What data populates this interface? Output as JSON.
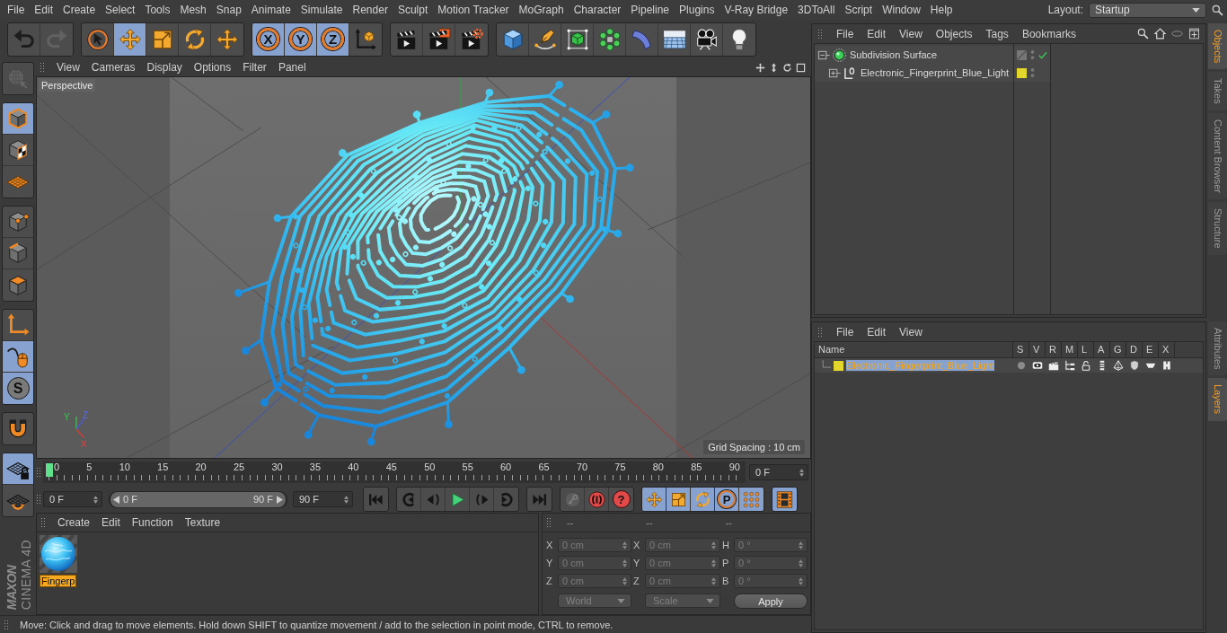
{
  "menu_bar": {
    "items": [
      "File",
      "Edit",
      "Create",
      "Select",
      "Tools",
      "Mesh",
      "Snap",
      "Animate",
      "Simulate",
      "Render",
      "Sculpt",
      "Motion Tracker",
      "MoGraph",
      "Character",
      "Pipeline",
      "Plugins",
      "V-Ray Bridge",
      "3DToAll",
      "Script",
      "Window",
      "Help"
    ],
    "layout_label": "Layout:",
    "layout_value": "Startup"
  },
  "toolbar": [
    [
      {
        "kind": "undo",
        "selected": false,
        "disabled": false
      },
      {
        "kind": "redo",
        "selected": false,
        "disabled": true
      }
    ],
    [
      {
        "kind": "select",
        "selected": false,
        "disabled": false
      },
      {
        "kind": "move",
        "selected": true,
        "disabled": false
      },
      {
        "kind": "scale",
        "selected": false,
        "disabled": false
      },
      {
        "kind": "rotate",
        "selected": false,
        "disabled": false
      },
      {
        "kind": "move",
        "selected": false,
        "disabled": false
      }
    ],
    [
      {
        "kind": "axis",
        "label": "X",
        "selected": true,
        "disabled": false
      },
      {
        "kind": "axis",
        "label": "Y",
        "selected": true,
        "disabled": false
      },
      {
        "kind": "axis",
        "label": "Z",
        "selected": true,
        "disabled": false
      },
      {
        "kind": "coords",
        "selected": false,
        "disabled": false
      }
    ],
    [
      {
        "kind": "render_view",
        "selected": false,
        "disabled": false
      },
      {
        "kind": "render_picture",
        "selected": false,
        "disabled": false
      },
      {
        "kind": "render_settings",
        "selected": false,
        "disabled": false
      }
    ],
    [
      {
        "kind": "cube",
        "selected": false,
        "disabled": false
      },
      {
        "kind": "pen",
        "selected": false,
        "disabled": false
      },
      {
        "kind": "subdivision",
        "selected": false,
        "disabled": false
      },
      {
        "kind": "cloner",
        "selected": false,
        "disabled": false
      },
      {
        "kind": "deformer",
        "selected": false,
        "disabled": false
      },
      {
        "kind": "floor",
        "selected": false,
        "disabled": false
      },
      {
        "kind": "camera",
        "selected": false,
        "disabled": false
      },
      {
        "kind": "light",
        "selected": false,
        "disabled": false
      }
    ]
  ],
  "tool_palette": [
    [
      {
        "kind": "make_editable",
        "selected": false,
        "disabled": true
      }
    ],
    [
      {
        "kind": "model",
        "selected": true,
        "disabled": false
      },
      {
        "kind": "texture",
        "selected": false,
        "disabled": false
      },
      {
        "kind": "workplane",
        "selected": false,
        "disabled": false
      }
    ],
    [
      {
        "kind": "points",
        "selected": false,
        "disabled": false
      },
      {
        "kind": "edges",
        "selected": false,
        "disabled": false
      },
      {
        "kind": "polygons",
        "selected": false,
        "disabled": false
      }
    ],
    [
      {
        "kind": "axis_mode",
        "selected": false,
        "disabled": false
      },
      {
        "kind": "tweak",
        "selected": true,
        "disabled": false
      },
      {
        "kind": "solo",
        "label": "S",
        "selected": true,
        "disabled": false
      }
    ],
    [
      {
        "kind": "snap",
        "selected": false,
        "disabled": false
      }
    ],
    [
      {
        "kind": "lock_workplane",
        "selected": true,
        "disabled": false
      },
      {
        "kind": "align_workplane",
        "selected": false,
        "disabled": false
      }
    ]
  ],
  "logo": {
    "brand": "MAXON",
    "product": "CINEMA 4D"
  },
  "viewport": {
    "menu": [
      "View",
      "Cameras",
      "Display",
      "Options",
      "Filter",
      "Panel"
    ],
    "camera": "Perspective",
    "axes": {
      "x": "X",
      "y": "Y",
      "z": "Z"
    },
    "grid_spacing": "Grid Spacing : 10 cm"
  },
  "timeline": {
    "ticks": [
      "0",
      "5",
      "10",
      "15",
      "20",
      "25",
      "30",
      "35",
      "40",
      "45",
      "50",
      "55",
      "60",
      "65",
      "70",
      "75",
      "80",
      "85",
      "90"
    ],
    "level": 0,
    "current_frame": "0 F"
  },
  "transport": {
    "start": "0 F",
    "range": {
      "start": "0 F",
      "end": "90 F",
      "level": 1
    },
    "end": "90 F",
    "groups": [
      [
        {
          "kind": "first",
          "selected": false,
          "disabled": false
        }
      ],
      [
        {
          "kind": "prev_key",
          "selected": false,
          "disabled": false
        },
        {
          "kind": "prev_frame",
          "selected": false,
          "disabled": false
        },
        {
          "kind": "play",
          "selected": false,
          "disabled": false
        },
        {
          "kind": "next_frame",
          "selected": false,
          "disabled": false
        },
        {
          "kind": "next_key",
          "selected": false,
          "disabled": false
        }
      ],
      [
        {
          "kind": "last",
          "selected": false,
          "disabled": false
        }
      ],
      [
        {
          "kind": "record",
          "selected": false,
          "disabled": true
        },
        {
          "kind": "autokey",
          "selected": false,
          "disabled": false
        },
        {
          "kind": "key_selection",
          "label": "?",
          "selected": false,
          "disabled": false
        }
      ],
      [
        {
          "kind": "move",
          "selected": true,
          "disabled": false
        },
        {
          "kind": "scale",
          "selected": true,
          "disabled": false
        },
        {
          "kind": "rotate",
          "selected": true,
          "disabled": false
        },
        {
          "kind": "param",
          "label": "P",
          "selected": true,
          "disabled": false
        },
        {
          "kind": "point_level",
          "selected": true,
          "disabled": false
        }
      ],
      [
        {
          "kind": "film",
          "selected": true,
          "disabled": false
        }
      ]
    ]
  },
  "materials": {
    "menu": [
      "Create",
      "Edit",
      "Function",
      "Texture"
    ],
    "items": [
      {
        "name": "Fingerp",
        "selected": true
      }
    ]
  },
  "coordinates": {
    "disabled": true,
    "headers": [
      "--",
      "--",
      "--"
    ],
    "rows": [
      {
        "label": "X",
        "value": "0 cm",
        "size_label": "X",
        "size_value": "0 cm",
        "angle_label": "H",
        "angle_value": "0 °"
      },
      {
        "label": "Y",
        "value": "0 cm",
        "size_label": "Y",
        "size_value": "0 cm",
        "angle_label": "P",
        "angle_value": "0 °"
      },
      {
        "label": "Z",
        "value": "0 cm",
        "size_label": "Z",
        "size_value": "0 cm",
        "angle_label": "B",
        "angle_value": "0 °"
      }
    ],
    "mode": "World",
    "size_mode": "Scale",
    "apply": "Apply"
  },
  "status_bar": "Move: Click and drag to move elements. Hold down SHIFT to quantize movement / add to the selection in point mode, CTRL to remove.",
  "object_manager": {
    "menu": [
      "File",
      "Edit",
      "View",
      "Objects",
      "Tags",
      "Bookmarks"
    ],
    "objects": [
      {
        "name": "Subdivision Surface",
        "kind": "subdivision",
        "expanded": true,
        "selected": false,
        "enabled": true,
        "children": [
          {
            "name": "Electronic_Fingerprint_Blue_Light",
            "kind": "null",
            "expanded": false,
            "selected": false,
            "enabled": false,
            "color": "#e2d62c"
          }
        ]
      }
    ]
  },
  "side_tabs_top": [
    {
      "label": "Objects",
      "selected": true
    },
    {
      "label": "Takes",
      "selected": false
    },
    {
      "label": "Content Browser",
      "selected": false
    },
    {
      "label": "Structure",
      "selected": false
    }
  ],
  "layer_manager": {
    "menu": [
      "File",
      "Edit",
      "View"
    ],
    "columns": [
      "Name",
      "S",
      "V",
      "R",
      "M",
      "L",
      "A",
      "G",
      "D",
      "E",
      "X"
    ],
    "layers": [
      {
        "name": "Electronic_Fingerprint_Blue_Light",
        "color": "#e2d62c",
        "selected": true,
        "flags": [
          {
            "kind": "solo",
            "on": false
          },
          {
            "kind": "view",
            "on": true
          },
          {
            "kind": "render",
            "on": true
          },
          {
            "kind": "manager",
            "on": true
          },
          {
            "kind": "locked",
            "on": false
          },
          {
            "kind": "animation",
            "on": true
          },
          {
            "kind": "generators",
            "on": true
          },
          {
            "kind": "deformers",
            "on": true
          },
          {
            "kind": "expressions",
            "on": true
          },
          {
            "kind": "xrefs",
            "on": true
          }
        ]
      }
    ]
  },
  "side_tabs_bottom": [
    {
      "label": "Attributes",
      "selected": false
    },
    {
      "label": "Layers",
      "selected": true
    }
  ]
}
